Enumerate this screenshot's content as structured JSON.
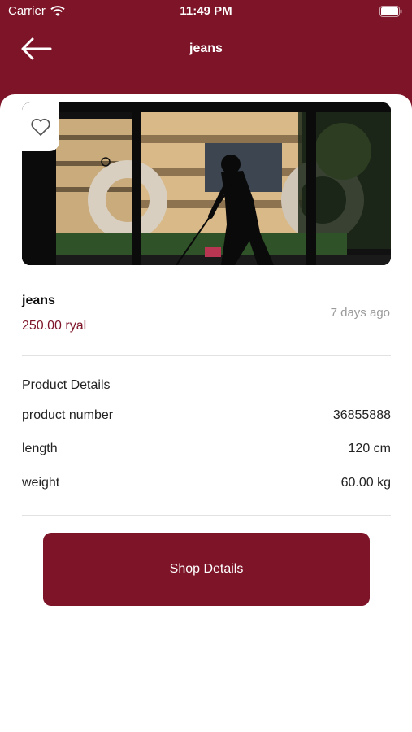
{
  "status_bar": {
    "carrier": "Carrier",
    "time": "11:49 PM"
  },
  "header": {
    "title": "jeans",
    "back_icon": "arrow-left-icon"
  },
  "product": {
    "name": "jeans",
    "price": "250.00 ryal",
    "posted": "7 days ago",
    "favorite_icon": "heart-outline-icon"
  },
  "details": {
    "section_title": "Product Details",
    "rows": [
      {
        "label": "product number",
        "value": "36855888"
      },
      {
        "label": "length",
        "value": "120 cm"
      },
      {
        "label": "weight",
        "value": "60.00 kg"
      }
    ]
  },
  "shop_button": {
    "label": "Shop Details"
  },
  "colors": {
    "brand": "#7d1428",
    "muted": "#9a9a9a",
    "divider": "#e2e2e2"
  }
}
